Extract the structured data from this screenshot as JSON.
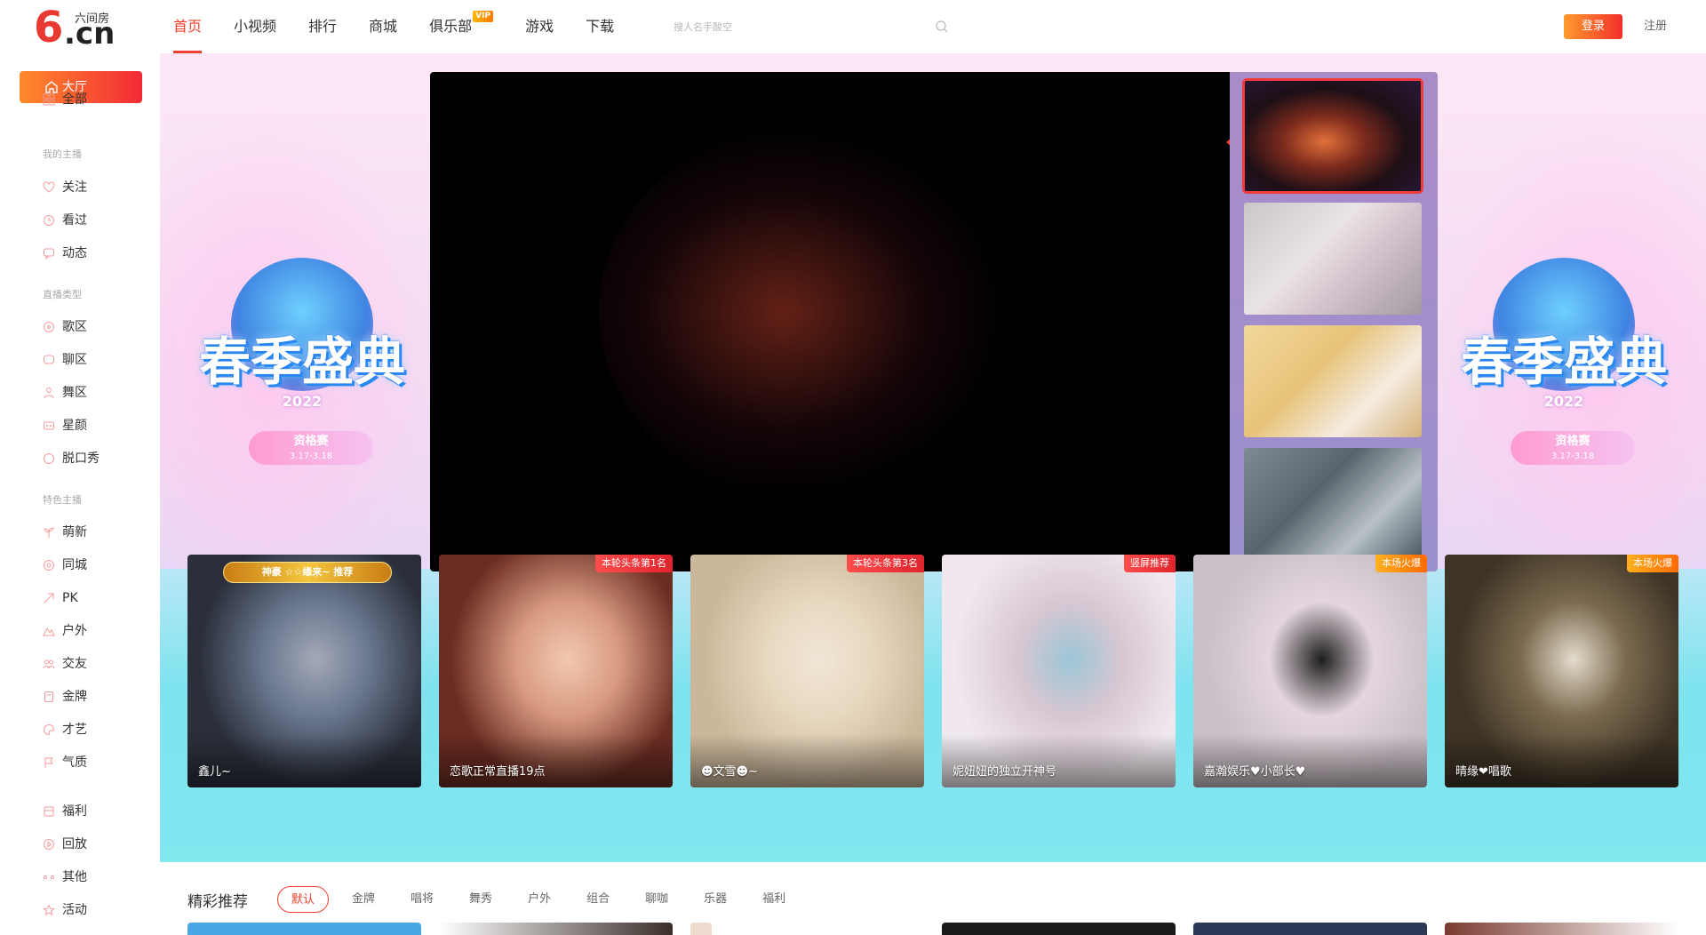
{
  "header": {
    "logo_six": "6",
    "logo_cn": ".cn",
    "logo_name": "六间房",
    "nav": [
      {
        "label": "首页",
        "active": true
      },
      {
        "label": "小视频"
      },
      {
        "label": "排行"
      },
      {
        "label": "商城"
      },
      {
        "label": "俱乐部",
        "badge": "VIP"
      },
      {
        "label": "游戏"
      },
      {
        "label": "下载"
      }
    ],
    "search_placeholder": "搜人名手酸空",
    "login": "登录",
    "register": "注册"
  },
  "sidebar": {
    "active": "大厅",
    "all": "全部",
    "group_my": "我的主播",
    "my_items": [
      "关注",
      "看过",
      "动态"
    ],
    "group_type": "直播类型",
    "type_items": [
      "歌区",
      "聊区",
      "舞区",
      "星颜",
      "脱口秀"
    ],
    "group_special": "特色主播",
    "special_items": [
      "萌新",
      "同城",
      "PK",
      "户外",
      "交友",
      "金牌",
      "才艺",
      "气质"
    ],
    "other_items": [
      "福利",
      "回放",
      "其他",
      "活动"
    ]
  },
  "banner": {
    "left_title": "春季盛典",
    "left_year": "2022",
    "left_pill_a": "资格赛",
    "left_pill_b": "3.17-3.18",
    "right_title": "春季盛典",
    "right_year": "2022",
    "right_pill_a": "资格赛",
    "right_pill_b": "3.17-3.18"
  },
  "cards": [
    {
      "name": "鑫儿~",
      "crown": "神豪 ☆☆缘来~ 推荐",
      "colors": [
        "#2a2f3a",
        "#6b7890",
        "#a3a9b8"
      ]
    },
    {
      "name": "恋歌正常直播19点",
      "tag": "本轮头条第1名",
      "tag_color": "red",
      "colors": [
        "#6b2c22",
        "#d79a80",
        "#f2c8b0"
      ]
    },
    {
      "name": "☻文雪☻~",
      "tag": "本轮头条第3名",
      "tag_color": "red",
      "colors": [
        "#cbb79b",
        "#e8d8c0",
        "#f0e6d6"
      ]
    },
    {
      "name": "妮妞妞的独立开神号",
      "tag": "竖屏推荐",
      "tag_color": "red",
      "colors": [
        "#f0e8ee",
        "#d8c7d2",
        "#9bc6d6"
      ]
    },
    {
      "name": "嘉瀚娱乐♥小部长♥",
      "tag": "本场火爆",
      "tag_color": "orange",
      "colors": [
        "#c9bfc6",
        "#e4d6de",
        "#1d1d1f"
      ]
    },
    {
      "name": "晴缘❤唱歌",
      "tag": "本场火爆",
      "tag_color": "orange",
      "colors": [
        "#3e3426",
        "#7b6a4e",
        "#e4dccd"
      ]
    }
  ],
  "recommend": {
    "title": "精彩推荐",
    "tabs": [
      "默认",
      "金牌",
      "唱将",
      "舞秀",
      "户外",
      "组合",
      "聊咖",
      "乐器",
      "福利"
    ]
  }
}
